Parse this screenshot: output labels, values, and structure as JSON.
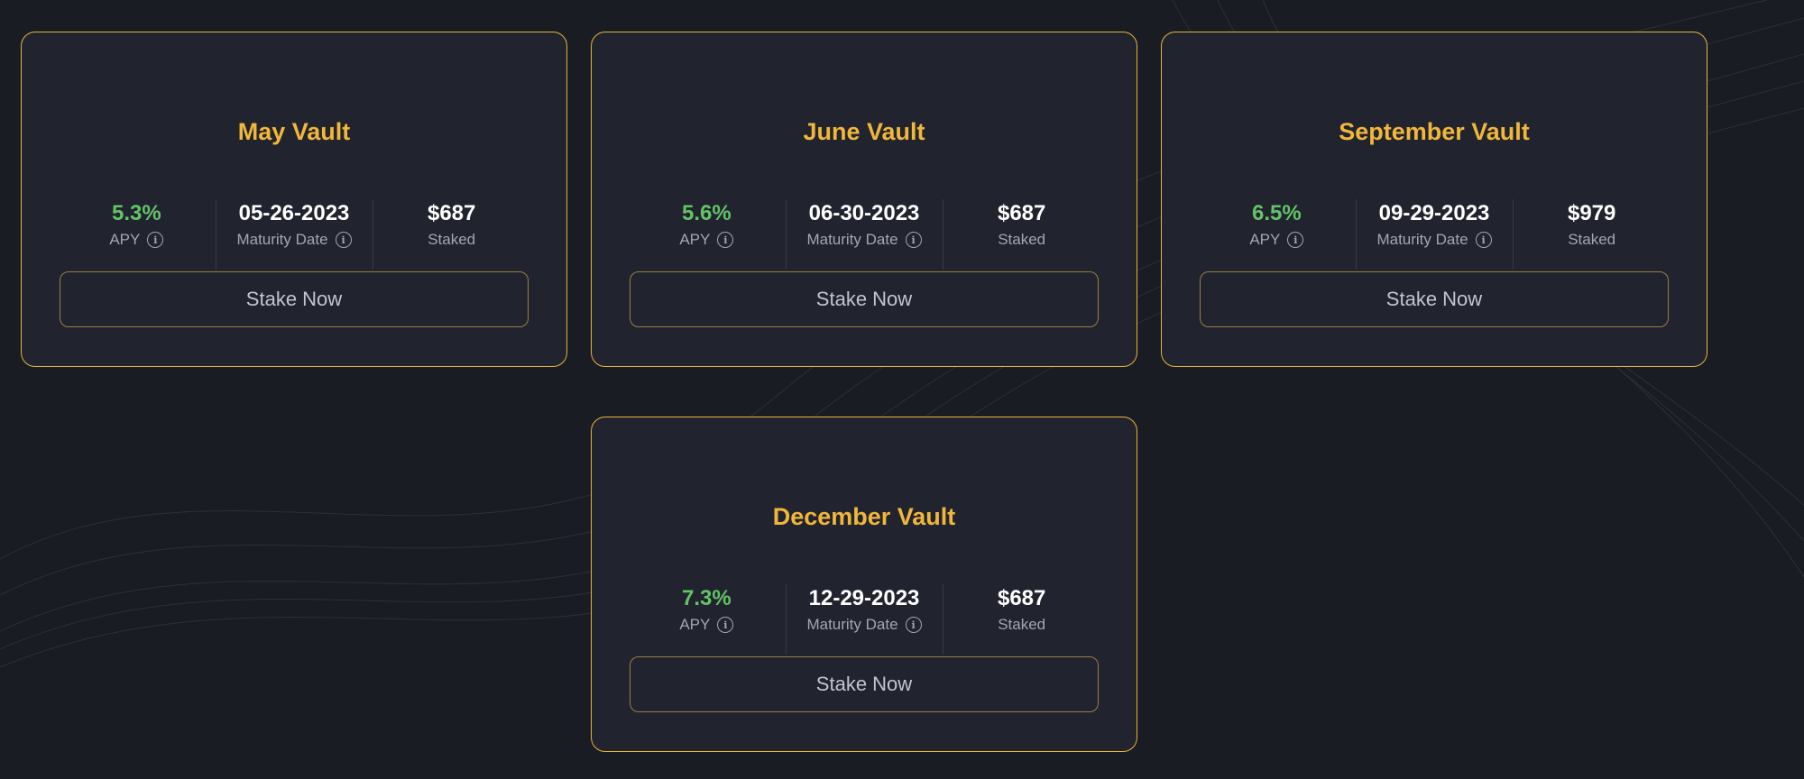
{
  "vaults": [
    {
      "title": "May Vault",
      "apy": "5.3%",
      "apy_label": "APY",
      "maturity": "05-26-2023",
      "maturity_label": "Maturity Date",
      "staked": "$687",
      "staked_label": "Staked",
      "button": "Stake Now"
    },
    {
      "title": "June Vault",
      "apy": "5.6%",
      "apy_label": "APY",
      "maturity": "06-30-2023",
      "maturity_label": "Maturity Date",
      "staked": "$687",
      "staked_label": "Staked",
      "button": "Stake Now"
    },
    {
      "title": "September Vault",
      "apy": "6.5%",
      "apy_label": "APY",
      "maturity": "09-29-2023",
      "maturity_label": "Maturity Date",
      "staked": "$979",
      "staked_label": "Staked",
      "button": "Stake Now"
    },
    {
      "title": "December Vault",
      "apy": "7.3%",
      "apy_label": "APY",
      "maturity": "12-29-2023",
      "maturity_label": "Maturity Date",
      "staked": "$687",
      "staked_label": "Staked",
      "button": "Stake Now"
    }
  ],
  "icons": {
    "info": "info-circle-icon"
  },
  "colors": {
    "accent": "#f0b73a",
    "positive": "#63c466",
    "background": "#1a1c24",
    "card": "#21232f"
  }
}
